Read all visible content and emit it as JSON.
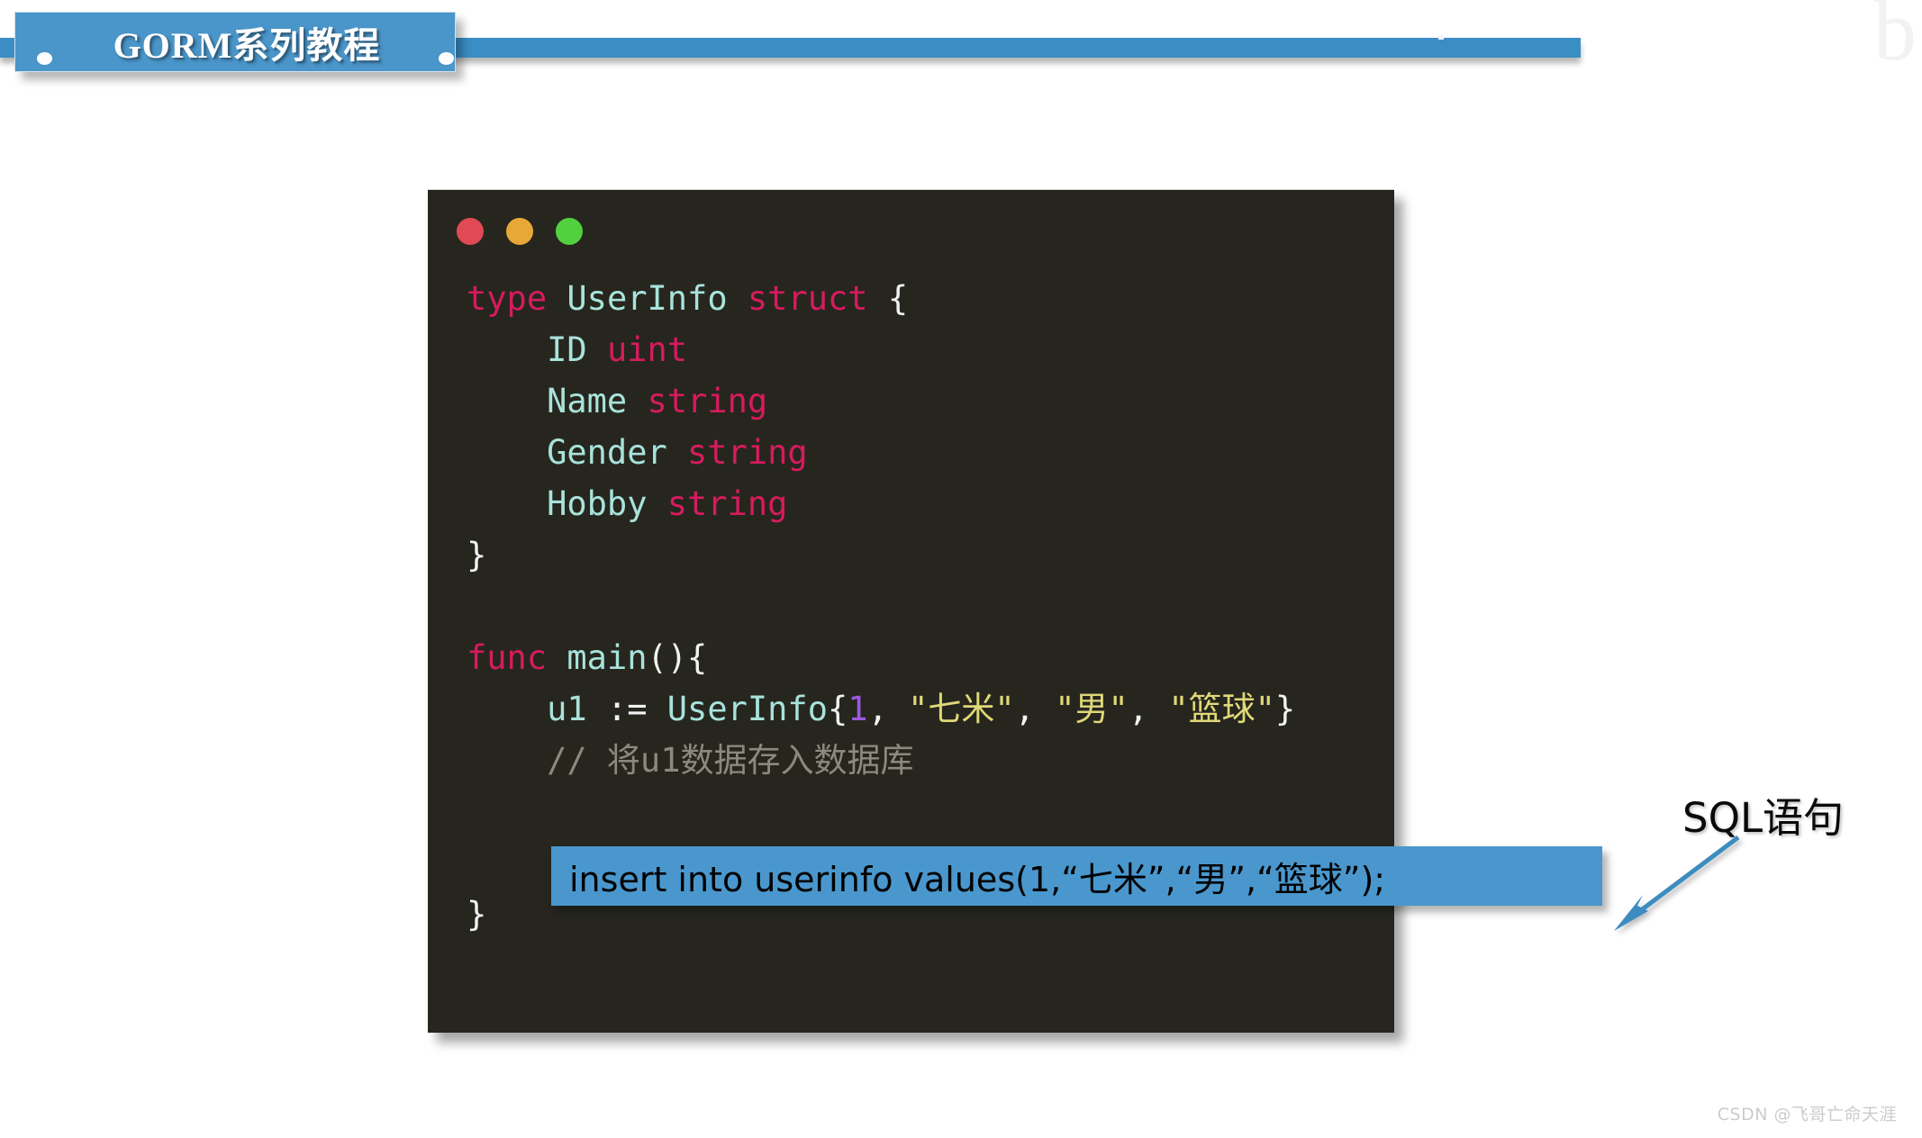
{
  "slide": {
    "banner_title": "GORM系列教程",
    "corner_glyph": "b",
    "watermark": "CSDN @飞哥亡命天涯"
  },
  "code_window": {
    "traffic_lights": [
      {
        "name": "close",
        "color": "#e04a54"
      },
      {
        "name": "minimize",
        "color": "#e8a838"
      },
      {
        "name": "maximize",
        "color": "#52d13e"
      }
    ],
    "language": "go",
    "lines": [
      {
        "tokens": [
          {
            "t": "type",
            "c": "kw"
          },
          {
            "t": " ",
            "c": "pun"
          },
          {
            "t": "UserInfo",
            "c": "id"
          },
          {
            "t": " ",
            "c": "pun"
          },
          {
            "t": "struct",
            "c": "kw"
          },
          {
            "t": " ",
            "c": "pun"
          },
          {
            "t": "{",
            "c": "pun"
          }
        ]
      },
      {
        "tokens": [
          {
            "t": "    ID ",
            "c": "id"
          },
          {
            "t": "uint",
            "c": "kw"
          }
        ]
      },
      {
        "tokens": [
          {
            "t": "    Name ",
            "c": "id"
          },
          {
            "t": "string",
            "c": "kw"
          }
        ]
      },
      {
        "tokens": [
          {
            "t": "    Gender ",
            "c": "id"
          },
          {
            "t": "string",
            "c": "kw"
          }
        ]
      },
      {
        "tokens": [
          {
            "t": "    Hobby ",
            "c": "id"
          },
          {
            "t": "string",
            "c": "kw"
          }
        ]
      },
      {
        "tokens": [
          {
            "t": "}",
            "c": "pun"
          }
        ]
      },
      {
        "tokens": [
          {
            "t": "",
            "c": "pun"
          }
        ]
      },
      {
        "tokens": [
          {
            "t": "func",
            "c": "kw"
          },
          {
            "t": " ",
            "c": "pun"
          },
          {
            "t": "main",
            "c": "id"
          },
          {
            "t": "(){",
            "c": "pun"
          }
        ]
      },
      {
        "tokens": [
          {
            "t": "    u1 ",
            "c": "id"
          },
          {
            "t": ":= ",
            "c": "pun"
          },
          {
            "t": "UserInfo",
            "c": "id"
          },
          {
            "t": "{",
            "c": "pun"
          },
          {
            "t": "1",
            "c": "num"
          },
          {
            "t": ", ",
            "c": "pun"
          },
          {
            "t": "\"七米\"",
            "c": "str"
          },
          {
            "t": ", ",
            "c": "pun"
          },
          {
            "t": "\"男\"",
            "c": "str"
          },
          {
            "t": ", ",
            "c": "pun"
          },
          {
            "t": "\"篮球\"",
            "c": "str"
          },
          {
            "t": "}",
            "c": "pun"
          }
        ]
      },
      {
        "tokens": [
          {
            "t": "    // 将u1数据存入数据库",
            "c": "com"
          }
        ]
      },
      {
        "tokens": [
          {
            "t": "",
            "c": "pun"
          }
        ]
      },
      {
        "tokens": [
          {
            "t": "",
            "c": "pun"
          }
        ]
      },
      {
        "tokens": [
          {
            "t": "}",
            "c": "pun"
          }
        ]
      }
    ]
  },
  "sql_highlight": {
    "text": "insert into userinfo values(1,“七米”,“男”,“篮球”);",
    "background": "#4a97cd",
    "text_color": "#000000"
  },
  "callout": {
    "label": "SQL语句",
    "arrow_color": "#3d8cc0"
  },
  "colors": {
    "banner_blue": "#4a95c9",
    "rail_blue": "#3b8ec4",
    "code_bg": "#26261f",
    "keyword": "#d61b5e",
    "identifier": "#a8e3da",
    "string": "#e0d878",
    "number": "#9b59e0",
    "comment": "#8a8a80",
    "punctuation": "#f2f2f2"
  }
}
